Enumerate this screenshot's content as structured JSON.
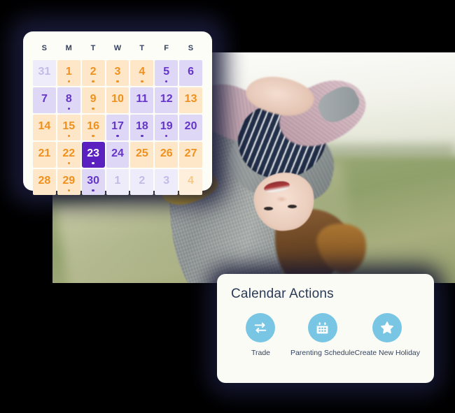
{
  "calendar": {
    "weekdays": [
      "S",
      "M",
      "T",
      "W",
      "T",
      "F",
      "S"
    ],
    "selected_day": "23",
    "colors": {
      "peach_bg": "#fde7c8",
      "peach_text": "#f0901e",
      "lavender_bg": "#ded7f5",
      "lavender_text": "#6435c9",
      "selected_bg": "#5b21c0",
      "selected_text": "#ffffff",
      "card_bg": "#fdfdf8"
    },
    "weeks": [
      [
        {
          "label": "31",
          "style": "mutelav",
          "dot": false
        },
        {
          "label": "1",
          "style": "peach",
          "dot": true
        },
        {
          "label": "2",
          "style": "peach",
          "dot": true
        },
        {
          "label": "3",
          "style": "peach",
          "dot": true
        },
        {
          "label": "4",
          "style": "peach",
          "dot": true
        },
        {
          "label": "5",
          "style": "lav",
          "dot": true
        },
        {
          "label": "6",
          "style": "lav",
          "dot": false
        }
      ],
      [
        {
          "label": "7",
          "style": "lav",
          "dot": false
        },
        {
          "label": "8",
          "style": "lav",
          "dot": true
        },
        {
          "label": "9",
          "style": "peach",
          "dot": true
        },
        {
          "label": "10",
          "style": "peach",
          "dot": false
        },
        {
          "label": "11",
          "style": "lav",
          "dot": false
        },
        {
          "label": "12",
          "style": "lav",
          "dot": false
        },
        {
          "label": "13",
          "style": "peach",
          "dot": false
        }
      ],
      [
        {
          "label": "14",
          "style": "peach",
          "dot": false
        },
        {
          "label": "15",
          "style": "peach",
          "dot": true
        },
        {
          "label": "16",
          "style": "peach",
          "dot": true
        },
        {
          "label": "17",
          "style": "lav",
          "dot": true
        },
        {
          "label": "18",
          "style": "lav",
          "dot": true
        },
        {
          "label": "19",
          "style": "lav",
          "dot": true
        },
        {
          "label": "20",
          "style": "lav",
          "dot": false
        }
      ],
      [
        {
          "label": "21",
          "style": "peach",
          "dot": false
        },
        {
          "label": "22",
          "style": "peach",
          "dot": true
        },
        {
          "label": "23",
          "style": "sel",
          "dot": true
        },
        {
          "label": "24",
          "style": "lav",
          "dot": false
        },
        {
          "label": "25",
          "style": "peach",
          "dot": false
        },
        {
          "label": "26",
          "style": "peach",
          "dot": false
        },
        {
          "label": "27",
          "style": "peach",
          "dot": false
        }
      ],
      [
        {
          "label": "28",
          "style": "peach",
          "dot": false
        },
        {
          "label": "29",
          "style": "peach",
          "dot": true
        },
        {
          "label": "30",
          "style": "lav",
          "dot": true
        },
        {
          "label": "1",
          "style": "mutelav",
          "dot": false
        },
        {
          "label": "2",
          "style": "mutelav",
          "dot": false
        },
        {
          "label": "3",
          "style": "mutelav",
          "dot": false
        },
        {
          "label": "4",
          "style": "mutepeach",
          "dot": false
        }
      ]
    ]
  },
  "actions": {
    "title": "Calendar Actions",
    "accent_color": "#79c6e4",
    "items": [
      {
        "label": "Trade",
        "icon": "swap-arrows-icon"
      },
      {
        "label": "Parenting Schedule",
        "icon": "calendar-icon"
      },
      {
        "label": "Create New Holiday",
        "icon": "star-icon"
      }
    ]
  },
  "photo": {
    "alt": "Adult holding a laughing child upside down in a grassy autumn field"
  }
}
